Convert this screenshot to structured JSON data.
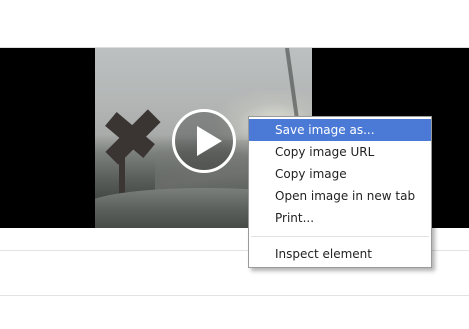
{
  "context_menu": {
    "items": [
      {
        "label": "Save image as...",
        "selected": true
      },
      {
        "label": "Copy image URL"
      },
      {
        "label": "Copy image"
      },
      {
        "label": "Open image in new tab"
      },
      {
        "label": "Print..."
      }
    ],
    "secondary_items": [
      {
        "label": "Inspect element"
      }
    ]
  },
  "video": {
    "play_icon": "play-icon"
  },
  "colors": {
    "selection_highlight": "#4b7ad6",
    "video_background": "#000000"
  }
}
